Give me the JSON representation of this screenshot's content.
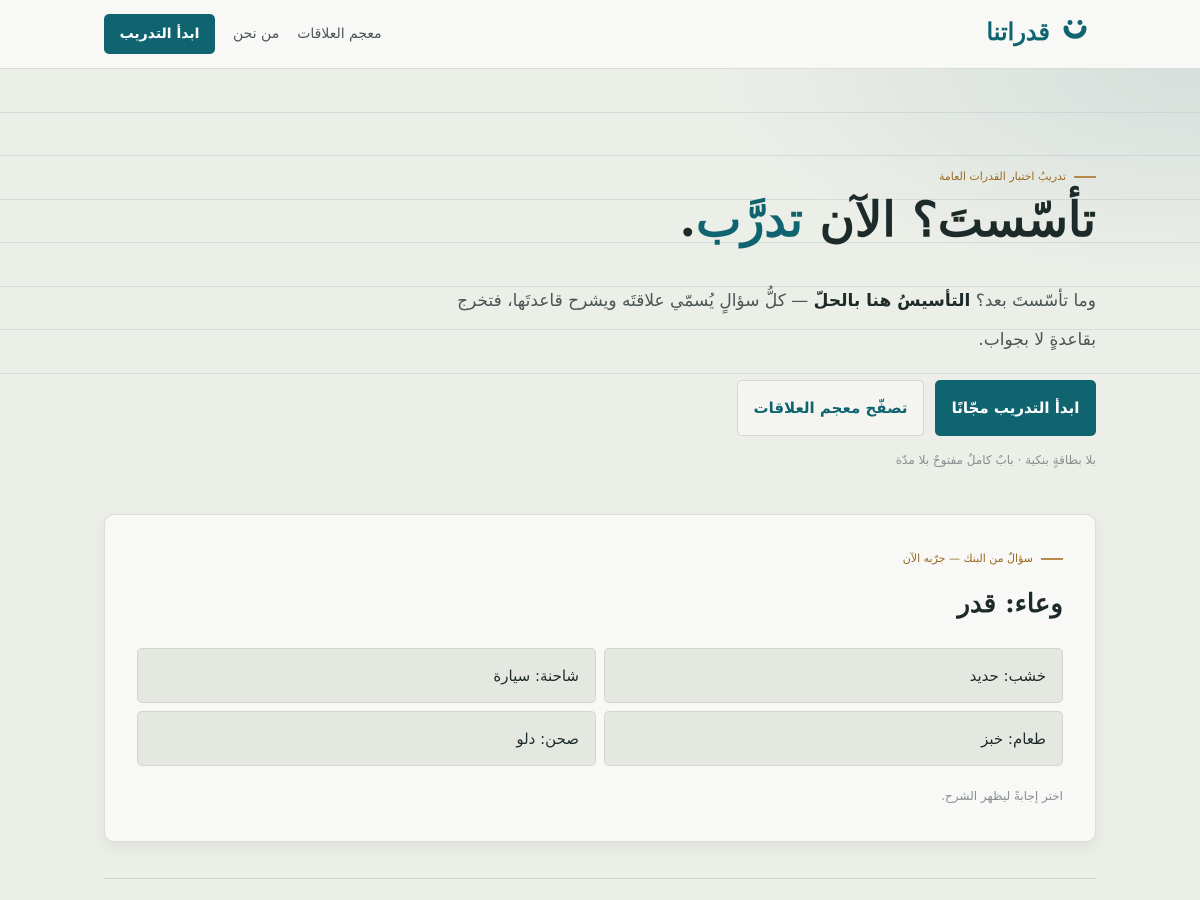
{
  "header": {
    "logo_text": "قدراتنا",
    "logo_icon": "qudratna-logo-icon",
    "nav": {
      "dictionary_link": "معجم العلاقات",
      "about_link": "من نحن",
      "start_button": "ابدأ التدريب"
    }
  },
  "hero": {
    "eyebrow": "تدريبُ اختبار القدرات العامة",
    "title_part1": "تأسّستَ؟ الآن ",
    "title_accent": "تدرَّب",
    "title_end": ".",
    "sub_part1": "وما تأسّستَ بعد؟ ",
    "sub_bold": "التأسيسُ هنا بالحلّ",
    "sub_part2": " — كلُّ سؤالٍ يُسمّي علاقتَه ويشرح قاعدتَها، فتخرج بقاعدةٍ لا بجواب.",
    "primary_button": "ابدأ التدريب مجّانًا",
    "secondary_button": "تصفّح معجم العلاقات",
    "note": "بلا بطاقةٍ بنكية · بابٌ كاملٌ مفتوحٌ بلا مدّة"
  },
  "sample_card": {
    "eyebrow": "سؤالٌ من البنك — جرّبه الآن",
    "question": "وعاء: قدر",
    "options": [
      "خشب: حديد",
      "شاحنة: سيارة",
      "طعام: خبز",
      "صحن: دلو"
    ],
    "hint": "اختر إجابةً ليظهر الشرح."
  },
  "colors": {
    "brand": "#0f6470",
    "eyebrow": "#9a6a1e",
    "background": "#eceee8"
  }
}
